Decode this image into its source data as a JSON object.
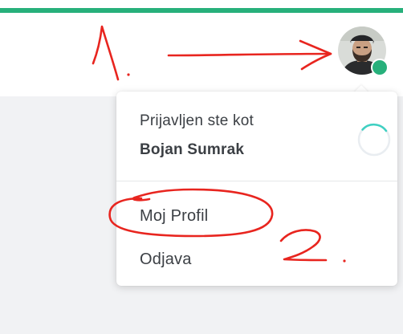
{
  "header": {
    "avatar": {
      "online": true
    }
  },
  "dropdown": {
    "signed_in_label": "Prijavljen ste kot",
    "user_name": "Bojan Sumrak",
    "items": [
      {
        "label": "Moj Profil"
      },
      {
        "label": "Odjava"
      }
    ]
  },
  "colors": {
    "accent": "#27b07b",
    "annotation": "#e8251f",
    "text": "#3b3f44"
  },
  "icons": {
    "avatar": "user-avatar-photo",
    "online": "online-status-dot",
    "spinner": "loading-spinner-icon"
  }
}
